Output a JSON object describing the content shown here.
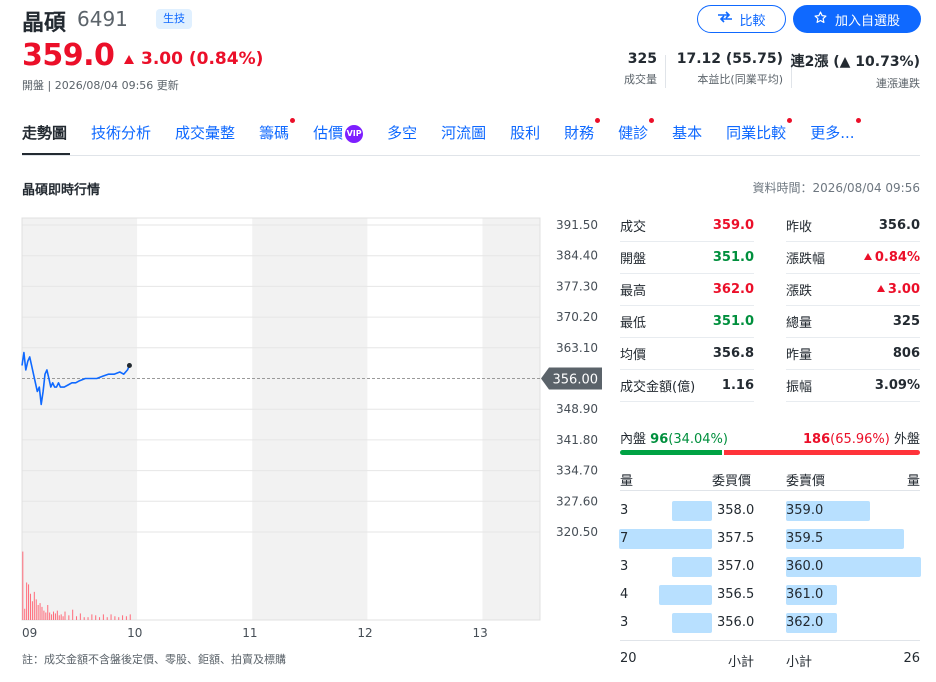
{
  "header": {
    "name": "晶碩",
    "code": "6491",
    "industry": "生技",
    "compare_label": "比較",
    "watchlist_label": "加入自選股",
    "price": "359.0",
    "change": "3.00 (0.84%)",
    "status": "開盤 | 2026/08/04 09:56 更新",
    "stats": [
      {
        "value": "325",
        "label": "成交量"
      },
      {
        "value": "17.12 (55.75)",
        "label": "本益比(同業平均)"
      },
      {
        "value": "連2漲 (▲ 10.73%)",
        "label": "連漲連跌"
      }
    ]
  },
  "tabs": [
    {
      "label": "走勢圖",
      "active": true,
      "dot": false
    },
    {
      "label": "技術分析",
      "dot": false
    },
    {
      "label": "成交彙整",
      "dot": false
    },
    {
      "label": "籌碼",
      "dot": true
    },
    {
      "label": "估價",
      "dot": false,
      "vip": "VIP"
    },
    {
      "label": "多空",
      "dot": false
    },
    {
      "label": "河流圖",
      "dot": false
    },
    {
      "label": "股利",
      "dot": false
    },
    {
      "label": "財務",
      "dot": true
    },
    {
      "label": "健診",
      "dot": true
    },
    {
      "label": "基本",
      "dot": false
    },
    {
      "label": "同業比較",
      "dot": true
    },
    {
      "label": "更多...",
      "dot": true
    }
  ],
  "section": {
    "title": "晶碩即時行情",
    "data_time": "資料時間：2026/08/04 09:56"
  },
  "chart_data": {
    "type": "line",
    "y_ticks": [
      "391.50",
      "384.40",
      "377.30",
      "370.20",
      "363.10",
      "348.90",
      "341.80",
      "334.70",
      "327.60",
      "320.50"
    ],
    "ylim": [
      320.5,
      391.5
    ],
    "reference_label": "356.00",
    "reference_value": 356.0,
    "x_ticks": [
      "09",
      "10",
      "11",
      "12",
      "13"
    ],
    "xlim_minutes": [
      0,
      270
    ],
    "price_series": {
      "minutes": [
        0,
        1,
        2,
        3,
        4,
        5,
        6,
        7,
        8,
        9,
        10,
        11,
        12,
        13,
        14,
        15,
        16,
        17,
        18,
        19,
        20,
        22,
        24,
        26,
        28,
        30,
        33,
        36,
        39,
        42,
        45,
        48,
        51,
        53,
        55,
        56
      ],
      "prices": [
        359,
        362,
        358,
        360,
        361,
        359,
        357,
        355,
        353,
        354,
        350,
        353,
        357,
        358,
        356,
        354,
        355,
        354,
        354,
        355,
        354,
        354,
        354.5,
        355,
        355,
        355.5,
        356,
        356,
        356,
        356.5,
        357,
        357,
        357.5,
        357,
        358,
        359
      ]
    },
    "volume_series": {
      "minutes": [
        0,
        1,
        2,
        3,
        4,
        5,
        6,
        7,
        8,
        9,
        10,
        11,
        12,
        13,
        14,
        15,
        16,
        17,
        18,
        19,
        20,
        21,
        22,
        24,
        26,
        28,
        30,
        32,
        34,
        36,
        38,
        40,
        42,
        44,
        46,
        48,
        50,
        52,
        54,
        56
      ],
      "volumes": [
        73,
        12,
        40,
        38,
        28,
        20,
        30,
        22,
        16,
        18,
        14,
        10,
        8,
        16,
        8,
        6,
        9,
        7,
        10,
        5,
        6,
        4,
        9,
        5,
        11,
        4,
        7,
        3,
        3,
        6,
        5,
        3,
        6,
        3,
        6,
        4,
        3,
        5,
        4,
        6
      ]
    }
  },
  "quote": {
    "left": [
      {
        "label": "成交",
        "value": "359.0",
        "color": "red"
      },
      {
        "label": "開盤",
        "value": "351.0",
        "color": "green"
      },
      {
        "label": "最高",
        "value": "362.0",
        "color": "red"
      },
      {
        "label": "最低",
        "value": "351.0",
        "color": "green"
      },
      {
        "label": "均價",
        "value": "356.8",
        "color": "dark"
      },
      {
        "label": "成交金額(億)",
        "value": "1.16",
        "color": "dark"
      }
    ],
    "right": [
      {
        "label": "昨收",
        "value": "356.0",
        "color": "dark",
        "tri": false
      },
      {
        "label": "漲跌幅",
        "value": "0.84%",
        "color": "red",
        "tri": true
      },
      {
        "label": "漲跌",
        "value": "3.00",
        "color": "red",
        "tri": true
      },
      {
        "label": "總量",
        "value": "325",
        "color": "dark",
        "tri": false
      },
      {
        "label": "昨量",
        "value": "806",
        "color": "dark",
        "tri": false
      },
      {
        "label": "振幅",
        "value": "3.09%",
        "color": "dark",
        "tri": false
      }
    ]
  },
  "inout": {
    "in_label": "內盤",
    "in_value": "96",
    "in_pct": "(34.04%)",
    "in_ratio": 0.3404,
    "out_value": "186",
    "out_pct": "(65.96%)",
    "out_label": "外盤"
  },
  "orderbook": {
    "headers": {
      "bid_qty": "量",
      "bid_price": "委買價",
      "ask_price": "委賣價",
      "ask_qty": "量"
    },
    "bids": [
      {
        "qty": "3",
        "price": "358.0",
        "q": 3
      },
      {
        "qty": "7",
        "price": "357.5",
        "q": 7
      },
      {
        "qty": "3",
        "price": "357.0",
        "q": 3
      },
      {
        "qty": "4",
        "price": "356.5",
        "q": 4
      },
      {
        "qty": "3",
        "price": "356.0",
        "q": 3
      }
    ],
    "asks": [
      {
        "price": "359.0",
        "qty": "5",
        "q": 5
      },
      {
        "price": "359.5",
        "qty": "7",
        "q": 7
      },
      {
        "price": "360.0",
        "qty": "8",
        "q": 8
      },
      {
        "price": "361.0",
        "qty": "3",
        "q": 3
      },
      {
        "price": "362.0",
        "qty": "3",
        "q": 3
      }
    ],
    "bid_total": "20",
    "bid_total_label": "小計",
    "ask_total_label": "小計",
    "ask_total": "26"
  },
  "footnote": "註：成交金額不含盤後定價、零股、鉅額、拍賣及標購",
  "colors": {
    "red": "#eb0f29",
    "green": "#008f3d",
    "blue": "#0f69ff",
    "line": "#0f69ff"
  }
}
